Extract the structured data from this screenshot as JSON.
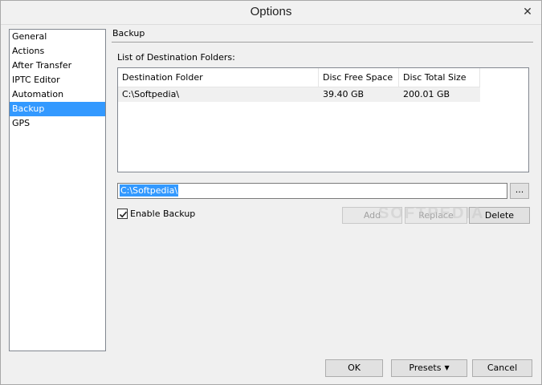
{
  "window": {
    "title": "Options",
    "close_glyph": "✕"
  },
  "nav": {
    "items": [
      {
        "label": "General"
      },
      {
        "label": "Actions"
      },
      {
        "label": "After Transfer"
      },
      {
        "label": "IPTC Editor"
      },
      {
        "label": "Automation"
      },
      {
        "label": "Backup",
        "selected": true
      },
      {
        "label": "GPS"
      }
    ]
  },
  "section": {
    "title": "Backup",
    "list_label": "List of Destination Folders:"
  },
  "table": {
    "columns": [
      "Destination Folder",
      "Disc Free Space",
      "Disc Total Size"
    ],
    "rows": [
      {
        "folder": "C:\\Softpedia\\",
        "free": "39.40 GB",
        "total": "200.01 GB"
      }
    ]
  },
  "path_input": {
    "value": "C:\\Softpedia\\"
  },
  "browse_button": {
    "label": "..."
  },
  "enable_backup": {
    "label": "Enable Backup",
    "checked": true
  },
  "buttons": {
    "add": "Add",
    "replace": "Replace",
    "delete": "Delete",
    "ok": "OK",
    "presets": "Presets",
    "cancel": "Cancel"
  },
  "watermark": {
    "text": "SOFTPEDIA"
  },
  "colors": {
    "selection": "#3399ff",
    "accent_text": "#ffffff"
  }
}
